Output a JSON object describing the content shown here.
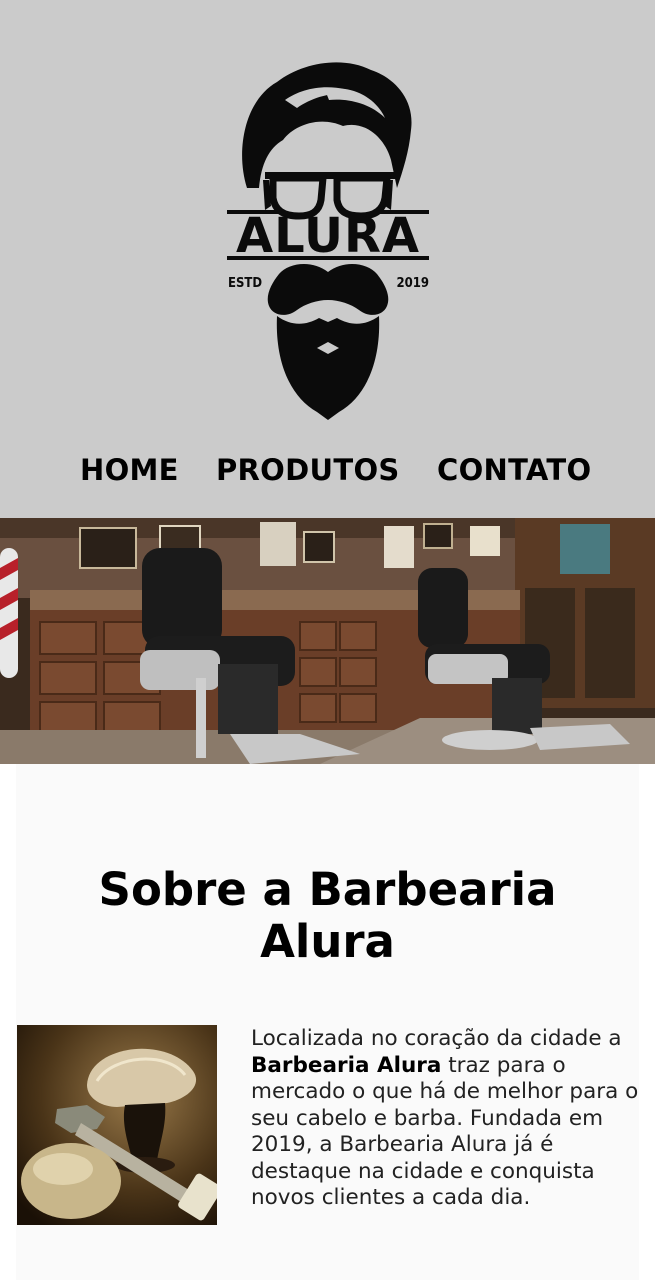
{
  "brand": {
    "name": "ALURA",
    "estd_label": "ESTD",
    "year": "2019"
  },
  "nav": {
    "items": [
      {
        "label": "HOME"
      },
      {
        "label": "PRODUTOS"
      },
      {
        "label": "CONTATO"
      }
    ]
  },
  "about": {
    "title_line1": "Sobre a Barbearia",
    "title_line2": "Alura",
    "text_before": "Localizada no coração da cidade a ",
    "text_bold": "Barbearia Alura",
    "text_after": " traz para o mercado o que há de melhor para o seu cabelo e barba. Fundada em 2019, a Barbearia Alura já é destaque na cidade e conquista novos clientes a cada dia."
  },
  "colors": {
    "header_bg": "#cbcbcb",
    "text": "#000000",
    "about_bg": "#fafafa"
  },
  "icons": {
    "logo": "bearded-man-logo",
    "banner": "barbershop-interior-photo",
    "about_image": "shaving-brush-razor-photo"
  }
}
